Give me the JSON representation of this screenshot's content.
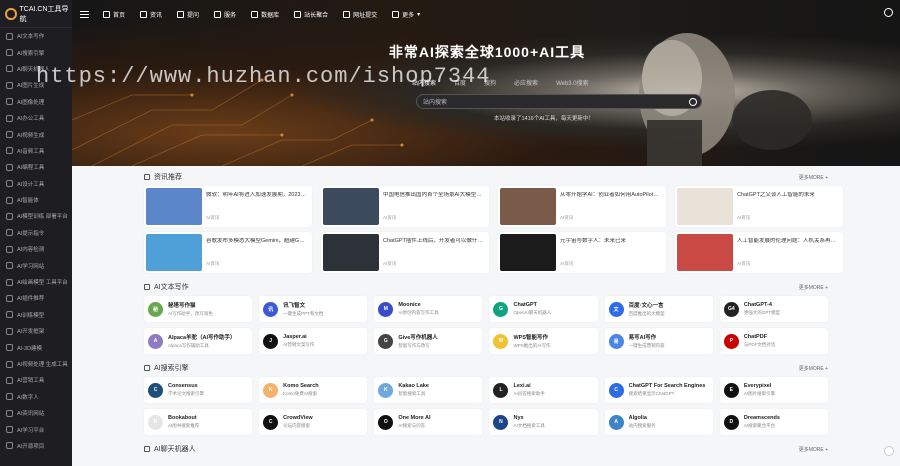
{
  "sidebar": {
    "logo_text": "TCAI.CN工具导航",
    "items": [
      {
        "label": "AI文本写作"
      },
      {
        "label": "AI搜索引擎"
      },
      {
        "label": "AI聊天机器人"
      },
      {
        "label": "AI图片生成"
      },
      {
        "label": "AI图像处理"
      },
      {
        "label": "AI办公工具"
      },
      {
        "label": "AI视频生成"
      },
      {
        "label": "AI音频工具"
      },
      {
        "label": "AI编程工具"
      },
      {
        "label": "AI设计工具"
      },
      {
        "label": "AI智能体"
      },
      {
        "label": "AI模型训练 部署平台"
      },
      {
        "label": "AI提示指令"
      },
      {
        "label": "AI内容检测"
      },
      {
        "label": "AI学习网站"
      },
      {
        "label": "AI绘画模型 工具平台"
      },
      {
        "label": "AI插件推荐"
      },
      {
        "label": "AI训练模型"
      },
      {
        "label": "AI开发框架"
      },
      {
        "label": "AI-3D建模"
      },
      {
        "label": "AI视频处理 生成工具"
      },
      {
        "label": "AI营销工具"
      },
      {
        "label": "AI数字人"
      },
      {
        "label": "AI资讯网站"
      },
      {
        "label": "AI学习平台"
      },
      {
        "label": "AI开源项目"
      }
    ]
  },
  "topnav": {
    "items": [
      {
        "label": "首页"
      },
      {
        "label": "资讯"
      },
      {
        "label": "提问"
      },
      {
        "label": "服务"
      },
      {
        "label": "数据库"
      },
      {
        "label": "站长聚合"
      },
      {
        "label": "网址提交"
      },
      {
        "label": "更多"
      }
    ]
  },
  "hero": {
    "title": "非常AI探索全球1000+AI工具",
    "tabs": [
      {
        "label": "站内搜索"
      },
      {
        "label": "百度"
      },
      {
        "label": "搜狗"
      },
      {
        "label": "必应搜索"
      },
      {
        "label": "Web3.0搜索"
      }
    ],
    "search_placeholder": "站内搜索",
    "hint": "本站收录了1416个AI工具，每天更新中！"
  },
  "watermark": "https://www.huzhan.com/ishop7344",
  "news": {
    "title": "资讯推荐",
    "more": "更多MORE +",
    "items": [
      {
        "title": "微软：明年AI将进入加速发展期，2023是关键年",
        "meta": "AI资讯",
        "color": "#5b86c9"
      },
      {
        "title": "中国电信推出国内首个全场景AI大模型，在多领域应用",
        "meta": "AI资讯",
        "color": "#3c4a5e"
      },
      {
        "title": "从零开始学AI：创业者如何用AutoPilot打造自己的业务",
        "meta": "AI资讯",
        "color": "#7a5a48"
      },
      {
        "title": "ChatGPT之父谈人工智能的未来",
        "meta": "AI资讯",
        "color": "#e8e2d8"
      },
      {
        "title": "谷歌发布多模态大模型Gemini，超越GPT-4",
        "meta": "AI资讯",
        "color": "#4fa0d9"
      },
      {
        "title": "ChatGPT插件上线后，开发者可以做什么？",
        "meta": "AI资讯",
        "color": "#2d3138"
      },
      {
        "title": "元宇宙与数字人：未来已来",
        "meta": "AI资讯",
        "color": "#1b1b1b"
      },
      {
        "title": "人工智能发展的伦理问题：人机关系再思考",
        "meta": "AI资讯",
        "color": "#c94a44"
      }
    ]
  },
  "text_tools": {
    "title": "AI文本写作",
    "more": "更多MORE +",
    "items": [
      {
        "name": "秘塔写作猫",
        "desc": "AI写作助手，改写润色",
        "color": "#6aa84f",
        "abbr": "秘"
      },
      {
        "name": "讯飞智文",
        "desc": "一键生成PPT和文档",
        "color": "#3d5bd9",
        "abbr": "讯"
      },
      {
        "name": "Moonice",
        "desc": "AI原创内容写作工具",
        "color": "#3b4cca",
        "abbr": "M"
      },
      {
        "name": "ChatGPT",
        "desc": "OpenAI聊天机器人",
        "color": "#10a37f",
        "abbr": "G"
      },
      {
        "name": "百度·文心一言",
        "desc": "百度推出的大模型",
        "color": "#2e6be6",
        "abbr": "文"
      },
      {
        "name": "ChatGPT-4",
        "desc": "更强大的GPT模型",
        "color": "#222",
        "abbr": "G4"
      },
      {
        "name": "Alpaca羊驼（AI写作助手）",
        "desc": "Alpaca写作辅助工具",
        "color": "#8e7cc3",
        "abbr": "A"
      },
      {
        "name": "Jasper.ai",
        "desc": "AI营销文案写作",
        "color": "#111",
        "abbr": "J"
      },
      {
        "name": "Give写作机器人",
        "desc": "智能写作与改写",
        "color": "#444",
        "abbr": "G"
      },
      {
        "name": "WPS智能写作",
        "desc": "WPS推出的AI写作",
        "color": "#f1c232",
        "abbr": "W"
      },
      {
        "name": "易写AI写作",
        "desc": "一键生成营销内容",
        "color": "#4a86e8",
        "abbr": "易"
      },
      {
        "name": "ChatPDF",
        "desc": "与PDF文档对话",
        "color": "#cc0000",
        "abbr": "P"
      }
    ]
  },
  "search_tools": {
    "title": "AI搜索引擎",
    "more": "更多MORE +",
    "items": [
      {
        "name": "Consensus",
        "desc": "学术论文搜索引擎",
        "color": "#1f4e79",
        "abbr": "C"
      },
      {
        "name": "Komo Search",
        "desc": "Komo免费AI搜索",
        "color": "#f6b26b",
        "abbr": "K"
      },
      {
        "name": "Kakao Lake",
        "desc": "智能搜索工具",
        "color": "#6fa8dc",
        "abbr": "K"
      },
      {
        "name": "Lexi.ai",
        "desc": "AI问答搜索助手",
        "color": "#222",
        "abbr": "L"
      },
      {
        "name": "ChatGPT For Search Engines",
        "desc": "搜索结果显示ChatGPT",
        "color": "#2e6be6",
        "abbr": "C"
      },
      {
        "name": "Everypixel",
        "desc": "AI图片搜索引擎",
        "color": "#111",
        "abbr": "E"
      },
      {
        "name": "Bookabout",
        "desc": "AI图书搜索推荐",
        "color": "#e6e6e6",
        "abbr": "B"
      },
      {
        "name": "CrowdView",
        "desc": "论坛内容搜索",
        "color": "#111",
        "abbr": "C"
      },
      {
        "name": "One More AI",
        "desc": "AI搜索与问答",
        "color": "#111",
        "abbr": "O"
      },
      {
        "name": "Nyx",
        "desc": "AI文档搜索工具",
        "color": "#1c4587",
        "abbr": "N"
      },
      {
        "name": "Algolia",
        "desc": "站内搜索服务",
        "color": "#3d85c6",
        "abbr": "A"
      },
      {
        "name": "Dreamscends",
        "desc": "AI搜索聚合平台",
        "color": "#111",
        "abbr": "D"
      }
    ]
  },
  "chat_section": {
    "title": "AI聊天机器人",
    "more": "更多MORE +"
  }
}
